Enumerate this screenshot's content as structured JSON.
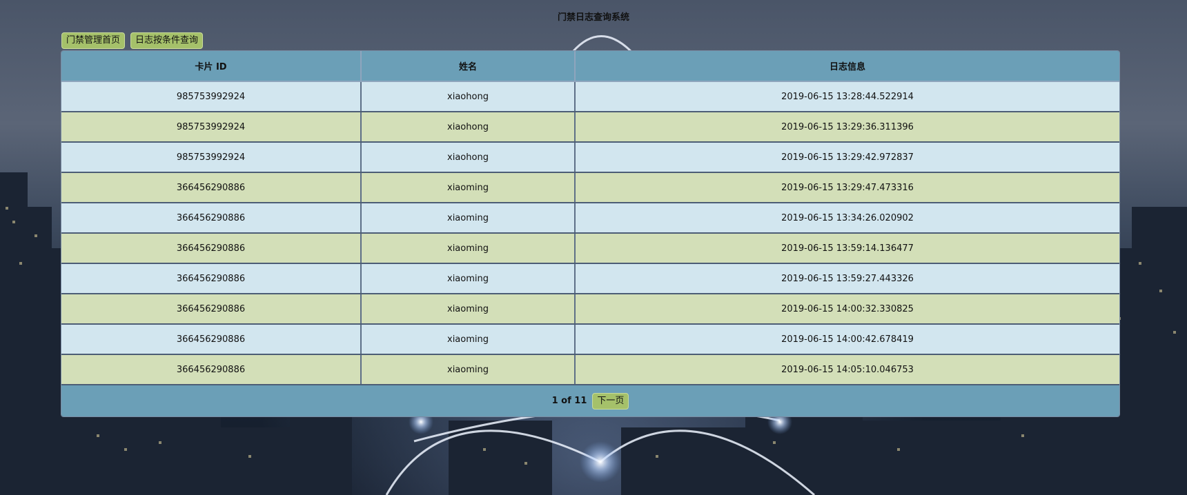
{
  "page": {
    "title": "门禁日志查询系统"
  },
  "nav": {
    "home_label": "门禁管理首页",
    "query_label": "日志按条件查询"
  },
  "table": {
    "headers": [
      "卡片 ID",
      "姓名",
      "日志信息"
    ],
    "rows": [
      {
        "card_id": "985753992924",
        "name": "xiaohong",
        "log": "2019-06-15 13:28:44.522914"
      },
      {
        "card_id": "985753992924",
        "name": "xiaohong",
        "log": "2019-06-15 13:29:36.311396"
      },
      {
        "card_id": "985753992924",
        "name": "xiaohong",
        "log": "2019-06-15 13:29:42.972837"
      },
      {
        "card_id": "366456290886",
        "name": "xiaoming",
        "log": "2019-06-15 13:29:47.473316"
      },
      {
        "card_id": "366456290886",
        "name": "xiaoming",
        "log": "2019-06-15 13:34:26.020902"
      },
      {
        "card_id": "366456290886",
        "name": "xiaoming",
        "log": "2019-06-15 13:59:14.136477"
      },
      {
        "card_id": "366456290886",
        "name": "xiaoming",
        "log": "2019-06-15 13:59:27.443326"
      },
      {
        "card_id": "366456290886",
        "name": "xiaoming",
        "log": "2019-06-15 14:00:32.330825"
      },
      {
        "card_id": "366456290886",
        "name": "xiaoming",
        "log": "2019-06-15 14:00:42.678419"
      },
      {
        "card_id": "366456290886",
        "name": "xiaoming",
        "log": "2019-06-15 14:05:10.046753"
      }
    ]
  },
  "pager": {
    "status": "1 of 11",
    "next_label": "下一页"
  },
  "colors": {
    "header_bg": "#6b9fb7",
    "row_blue": "#d2e6ef",
    "row_green": "#d3dfb8",
    "button_bg": "#a5c16a"
  }
}
